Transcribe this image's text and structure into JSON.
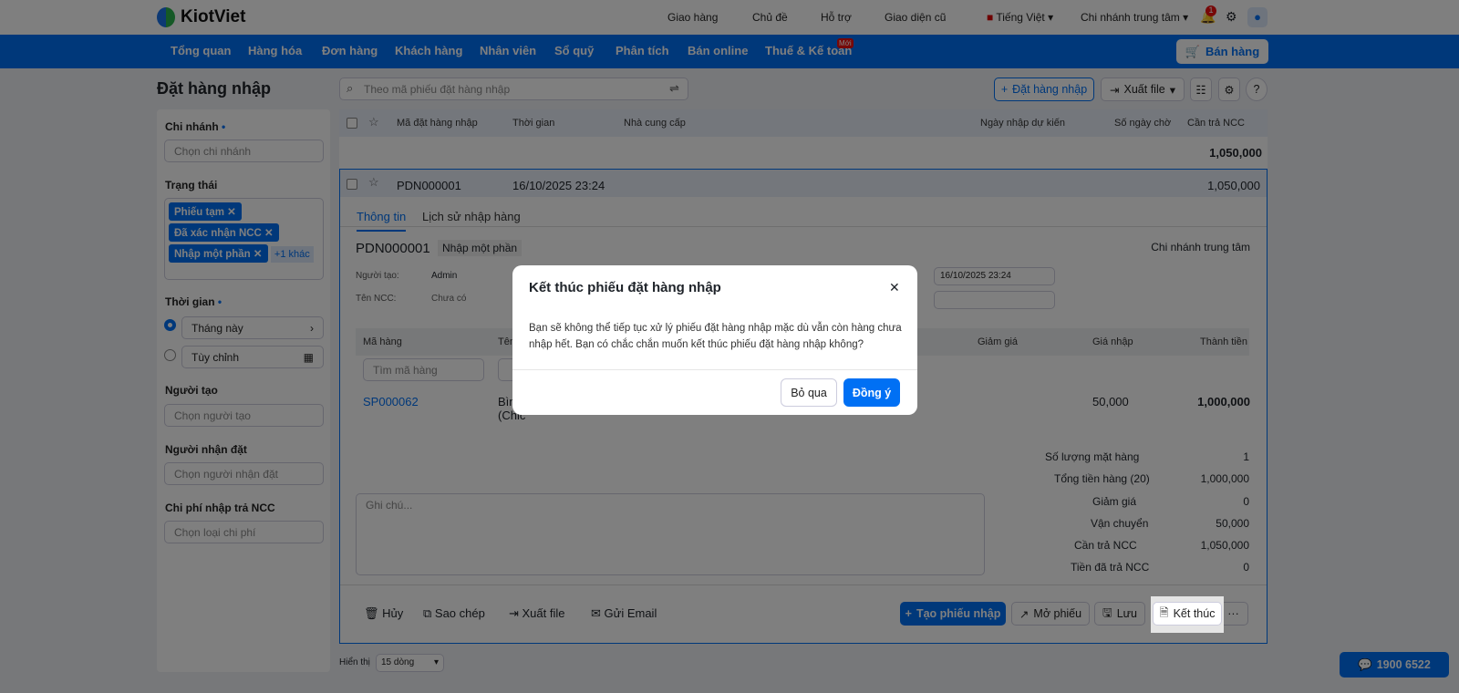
{
  "app": {
    "logo": "KiotViet"
  },
  "topbar": {
    "delivery": "Giao hàng",
    "theme": "Chủ đề",
    "support": "Hỗ trợ",
    "old_ui": "Giao diện cũ",
    "language": "Tiếng Việt",
    "branch": "Chi nhánh trung tâm",
    "notif_count": "1"
  },
  "nav": {
    "items": [
      "Tổng quan",
      "Hàng hóa",
      "Đơn hàng",
      "Khách hàng",
      "Nhân viên",
      "Sổ quỹ",
      "Phân tích",
      "Bán online",
      "Thuế & Kế toán"
    ],
    "new_badge": "Mới",
    "sell": "Bán hàng"
  },
  "page": {
    "title": "Đặt hàng nhập",
    "search_placeholder": "Theo mã phiếu đặt hàng nhập",
    "add": "Đặt hàng nhập",
    "export": "Xuất file"
  },
  "filters": {
    "branch_label": "Chi nhánh",
    "branch_ph": "Chọn chi nhánh",
    "status_label": "Trạng thái",
    "status_tags": [
      "Phiếu tạm",
      "Đã xác nhận NCC",
      "Nhập một phần"
    ],
    "status_more": "+1 khác",
    "time_label": "Thời gian",
    "time_this": "Tháng này",
    "time_custom": "Tùy chỉnh",
    "creator_label": "Người tạo",
    "creator_ph": "Chọn người tạo",
    "receiver_label": "Người nhận đặt",
    "receiver_ph": "Chọn người nhận đặt",
    "cost_label": "Chi phí nhập trả NCC",
    "cost_ph": "Chọn loại chi phí"
  },
  "table": {
    "headers": [
      "Mã đặt hàng nhập",
      "Thời gian",
      "Nhà cung cấp",
      "Ngày nhập dự kiến",
      "Số ngày chờ",
      "Cần trả NCC"
    ],
    "total": "1,050,000",
    "row": {
      "code": "PDN000001",
      "time": "16/10/2025 23:24",
      "amount": "1,050,000"
    }
  },
  "detail": {
    "tabs": [
      "Thông tin",
      "Lịch sử nhập hàng"
    ],
    "code": "PDN000001",
    "status": "Nhập một phần",
    "branch": "Chi nhánh trung tâm",
    "creator_label": "Người tạo:",
    "creator": "Admin",
    "supplier_label": "Tên NCC:",
    "supplier": "Chưa có",
    "date": "16/10/2025 23:24",
    "item_headers": [
      "Mã hàng",
      "Tên",
      "Giảm giá",
      "Giá nhập",
      "Thành tiền"
    ],
    "search_code_ph": "Tìm mã hàng",
    "item": {
      "code": "SP000062",
      "name": "Bìn",
      "name2": "(Chic",
      "price": "50,000",
      "total": "1,000,000"
    },
    "note_ph": "Ghi chú...",
    "summary": [
      {
        "label": "Số lượng mặt hàng",
        "value": "1"
      },
      {
        "label": "Tổng tiền hàng (20)",
        "value": "1,000,000"
      },
      {
        "label": "Giảm giá",
        "value": "0"
      },
      {
        "label": "Vận chuyển",
        "value": "50,000"
      },
      {
        "label": "Cần trả NCC",
        "value": "1,050,000"
      },
      {
        "label": "Tiền đã trả NCC",
        "value": "0"
      }
    ],
    "actions": {
      "cancel": "Hủy",
      "copy": "Sao chép",
      "export": "Xuất file",
      "email": "Gửi Email",
      "create": "Tạo phiếu nhập",
      "open": "Mở phiếu",
      "save": "Lưu",
      "finish": "Kết thúc"
    }
  },
  "footer": {
    "show": "Hiển thị",
    "rows": "15 dòng",
    "hotline": "1900 6522"
  },
  "modal": {
    "title": "Kết thúc phiếu đặt hàng nhập",
    "body": "Bạn sẽ không thể tiếp tục xử lý phiếu đặt hàng nhập mặc dù vẫn còn hàng chưa nhập hết. Bạn có chắc chắn muốn kết thúc phiếu đặt hàng nhập không?",
    "skip": "Bỏ qua",
    "ok": "Đồng ý"
  }
}
